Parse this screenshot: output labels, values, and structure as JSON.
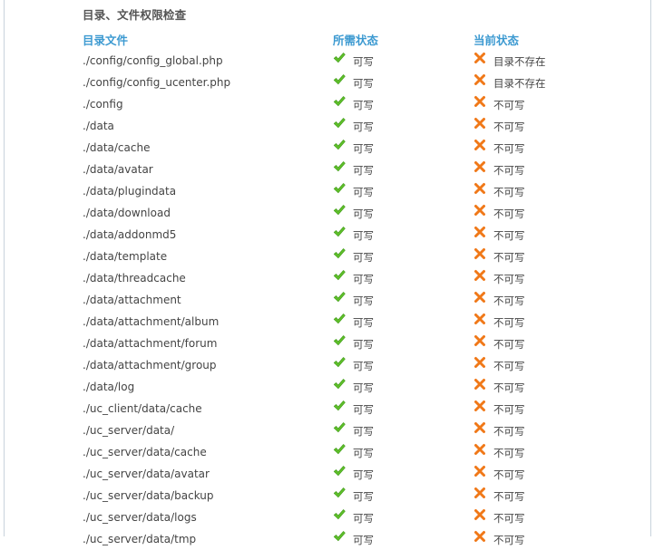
{
  "section_title": "目录、文件权限检查",
  "headers": {
    "name": "目录文件",
    "required": "所需状态",
    "current": "当前状态"
  },
  "colors": {
    "header": "#3d9ad1",
    "check": "#5fbf2a",
    "cross": "#f07818"
  },
  "icons": {
    "ok": "check-icon",
    "fail": "cross-icon"
  },
  "rows": [
    {
      "path": "./config/config_global.php",
      "required": "可写",
      "current": "目录不存在"
    },
    {
      "path": "./config/config_ucenter.php",
      "required": "可写",
      "current": "目录不存在"
    },
    {
      "path": "./config",
      "required": "可写",
      "current": "不可写"
    },
    {
      "path": "./data",
      "required": "可写",
      "current": "不可写"
    },
    {
      "path": "./data/cache",
      "required": "可写",
      "current": "不可写"
    },
    {
      "path": "./data/avatar",
      "required": "可写",
      "current": "不可写"
    },
    {
      "path": "./data/plugindata",
      "required": "可写",
      "current": "不可写"
    },
    {
      "path": "./data/download",
      "required": "可写",
      "current": "不可写"
    },
    {
      "path": "./data/addonmd5",
      "required": "可写",
      "current": "不可写"
    },
    {
      "path": "./data/template",
      "required": "可写",
      "current": "不可写"
    },
    {
      "path": "./data/threadcache",
      "required": "可写",
      "current": "不可写"
    },
    {
      "path": "./data/attachment",
      "required": "可写",
      "current": "不可写"
    },
    {
      "path": "./data/attachment/album",
      "required": "可写",
      "current": "不可写"
    },
    {
      "path": "./data/attachment/forum",
      "required": "可写",
      "current": "不可写"
    },
    {
      "path": "./data/attachment/group",
      "required": "可写",
      "current": "不可写"
    },
    {
      "path": "./data/log",
      "required": "可写",
      "current": "不可写"
    },
    {
      "path": "./uc_client/data/cache",
      "required": "可写",
      "current": "不可写"
    },
    {
      "path": "./uc_server/data/",
      "required": "可写",
      "current": "不可写"
    },
    {
      "path": "./uc_server/data/cache",
      "required": "可写",
      "current": "不可写"
    },
    {
      "path": "./uc_server/data/avatar",
      "required": "可写",
      "current": "不可写"
    },
    {
      "path": "./uc_server/data/backup",
      "required": "可写",
      "current": "不可写"
    },
    {
      "path": "./uc_server/data/logs",
      "required": "可写",
      "current": "不可写"
    },
    {
      "path": "./uc_server/data/tmp",
      "required": "可写",
      "current": "不可写"
    }
  ]
}
